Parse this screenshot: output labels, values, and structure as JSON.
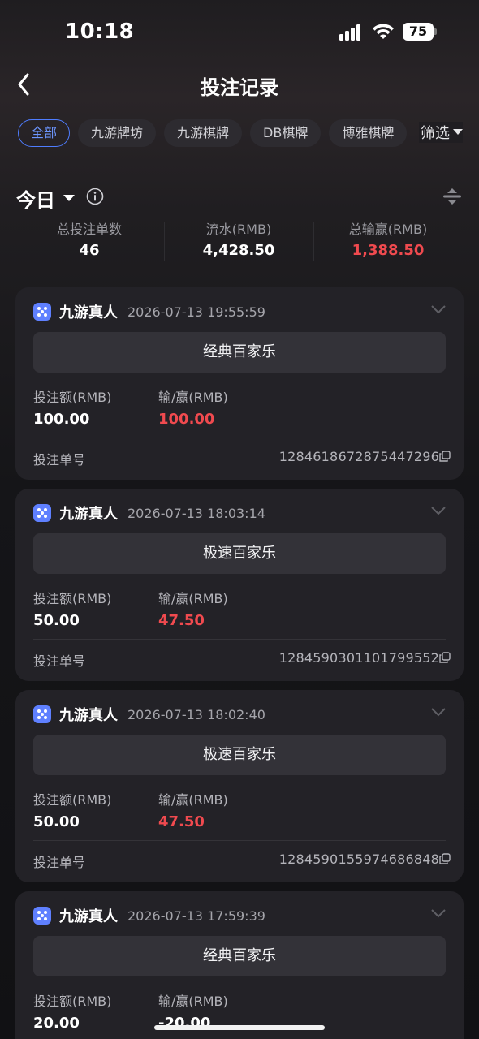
{
  "status_bar": {
    "time": "10:18",
    "battery": "75"
  },
  "header": {
    "title": "投注记录"
  },
  "tabs": [
    {
      "label": "全部"
    },
    {
      "label": "九游牌坊"
    },
    {
      "label": "九游棋牌"
    },
    {
      "label": "DB棋牌"
    },
    {
      "label": "博雅棋牌"
    }
  ],
  "filter": {
    "label": "筛选"
  },
  "summary": {
    "period": "今日",
    "stats": [
      {
        "label": "总投注单数",
        "value": "46"
      },
      {
        "label": "流水(RMB)",
        "value": "4,428.50"
      },
      {
        "label": "总输赢(RMB)",
        "value": "1,388.50"
      }
    ]
  },
  "bet_field_labels": {
    "amount": "投注额(RMB)",
    "win_loss": "输/赢(RMB)",
    "order_no": "投注单号"
  },
  "bets": [
    {
      "vendor": "九游真人",
      "time": "2026-07-13 19:55:59",
      "game": "经典百家乐",
      "amount": "100.00",
      "win_loss": "100.00",
      "order_no": "1284618672875447296"
    },
    {
      "vendor": "九游真人",
      "time": "2026-07-13 18:03:14",
      "game": "极速百家乐",
      "amount": "50.00",
      "win_loss": "47.50",
      "order_no": "1284590301101799552"
    },
    {
      "vendor": "九游真人",
      "time": "2026-07-13 18:02:40",
      "game": "极速百家乐",
      "amount": "50.00",
      "win_loss": "47.50",
      "order_no": "1284590155974686848"
    },
    {
      "vendor": "九游真人",
      "time": "2026-07-13 17:59:39",
      "game": "经典百家乐",
      "amount": "20.00",
      "win_loss": "-20.00",
      "order_no": ""
    }
  ],
  "colors": {
    "accent": "#4f7dff",
    "win": "#f04a4f",
    "card_bg": "#232227"
  },
  "icons": [
    "back-arrow-icon",
    "caret-down-icon",
    "info-icon",
    "sort-icon",
    "dice-icon",
    "chevron-down-icon",
    "copy-icon"
  ]
}
